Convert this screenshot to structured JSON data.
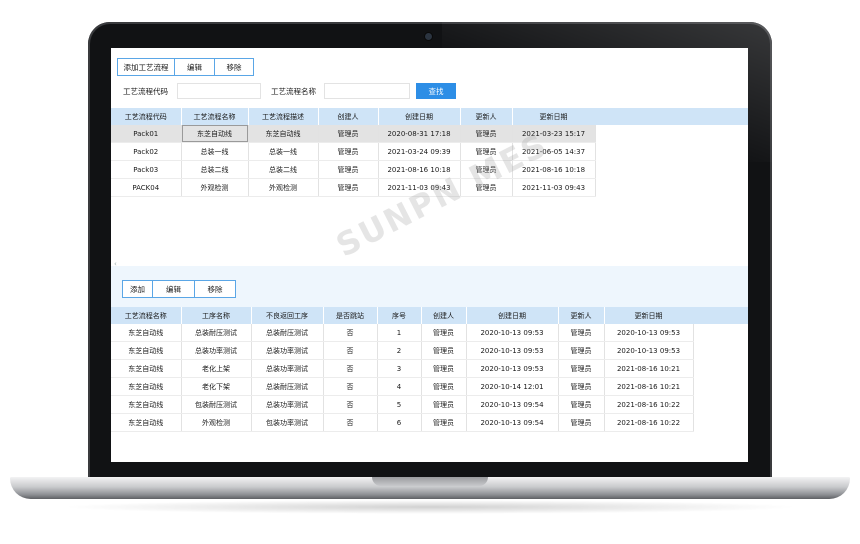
{
  "toolbar_top": {
    "add": "添加工艺流程",
    "edit": "编辑",
    "remove": "移除"
  },
  "filters": {
    "code_label": "工艺流程代码",
    "name_label": "工艺流程名称",
    "search": "查找"
  },
  "process_table": {
    "headers": [
      "工艺流程代码",
      "工艺流程名称",
      "工艺流程描述",
      "创建人",
      "创建日期",
      "更新人",
      "更新日期"
    ],
    "rows": [
      [
        "Pack01",
        "东芝自动线",
        "东芝自动线",
        "管理员",
        "2020-08-31 17:18",
        "管理员",
        "2021-03-23 15:17"
      ],
      [
        "Pack02",
        "总装一线",
        "总装一线",
        "管理员",
        "2021-03-24 09:39",
        "管理员",
        "2021-06-05 14:37"
      ],
      [
        "Pack03",
        "总装二线",
        "总装二线",
        "管理员",
        "2021-08-16 10:18",
        "管理员",
        "2021-08-16 10:18"
      ],
      [
        "PACK04",
        "外观检测",
        "外观检测",
        "管理员",
        "2021-11-03 09:43",
        "管理员",
        "2021-11-03 09:43"
      ]
    ]
  },
  "toolbar_bottom": {
    "add": "添加",
    "edit": "编辑",
    "remove": "移除"
  },
  "step_table": {
    "headers": [
      "工艺流程名称",
      "工序名称",
      "不良返回工序",
      "是否跳站",
      "序号",
      "创建人",
      "创建日期",
      "更新人",
      "更新日期"
    ],
    "rows": [
      [
        "东芝自动线",
        "总装耐压测试",
        "总装耐压测试",
        "否",
        "1",
        "管理员",
        "2020-10-13 09:53",
        "管理员",
        "2020-10-13 09:53"
      ],
      [
        "东芝自动线",
        "总装功率测试",
        "总装功率测试",
        "否",
        "2",
        "管理员",
        "2020-10-13 09:53",
        "管理员",
        "2020-10-13 09:53"
      ],
      [
        "东芝自动线",
        "老化上架",
        "总装功率测试",
        "否",
        "3",
        "管理员",
        "2020-10-13 09:53",
        "管理员",
        "2021-08-16 10:21"
      ],
      [
        "东芝自动线",
        "老化下架",
        "总装耐压测试",
        "否",
        "4",
        "管理员",
        "2020-10-14 12:01",
        "管理员",
        "2021-08-16 10:21"
      ],
      [
        "东芝自动线",
        "包装耐压测试",
        "总装功率测试",
        "否",
        "5",
        "管理员",
        "2020-10-13 09:54",
        "管理员",
        "2021-08-16 10:22"
      ],
      [
        "东芝自动线",
        "外观检测",
        "包装功率测试",
        "否",
        "6",
        "管理员",
        "2020-10-13 09:54",
        "管理员",
        "2021-08-16 10:22"
      ]
    ]
  },
  "watermark": "SUNPN MES",
  "colors": {
    "header_bg": "#cfe4f7",
    "accent": "#2d8ee6",
    "button_border": "#5aa6e6"
  }
}
